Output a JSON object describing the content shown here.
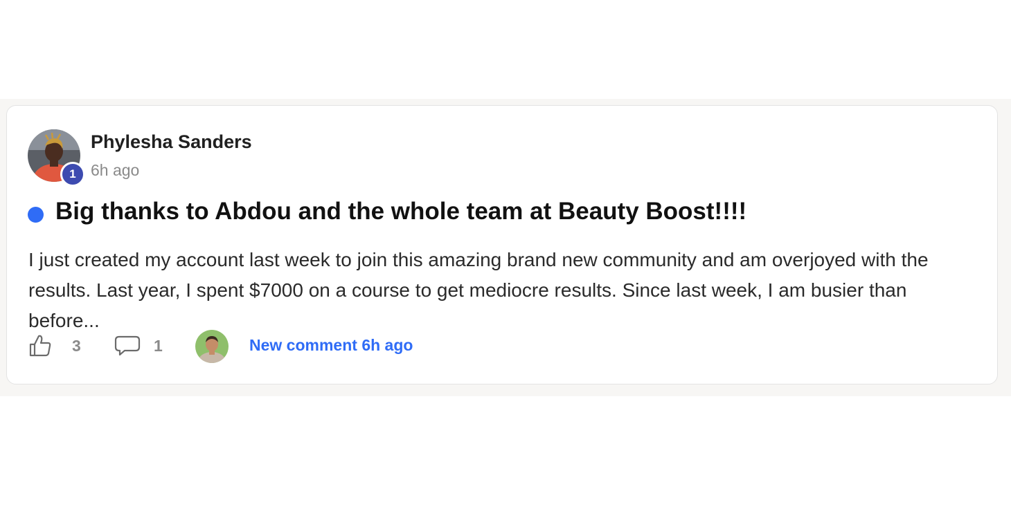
{
  "post": {
    "author": {
      "name": "Phylesha Sanders",
      "level": "1"
    },
    "timestamp": "6h ago",
    "title": "Big thanks to Abdou and the whole team at Beauty Boost!!!!",
    "body": "I just created my account last week to join this amazing brand new community and am overjoyed with the results. Last year, I spent $7000 on a course to get mediocre results. Since last week, I am busier than before...",
    "likes": "3",
    "comments": "1",
    "latest_comment": "New comment 6h ago"
  },
  "icons": {
    "like": "thumbs-up-icon",
    "comment": "speech-bubble-icon",
    "unread": "unread-dot"
  },
  "colors": {
    "accent": "#2f6cf6",
    "level_badge": "#3d4bb0",
    "background_band": "#f7f6f4"
  }
}
